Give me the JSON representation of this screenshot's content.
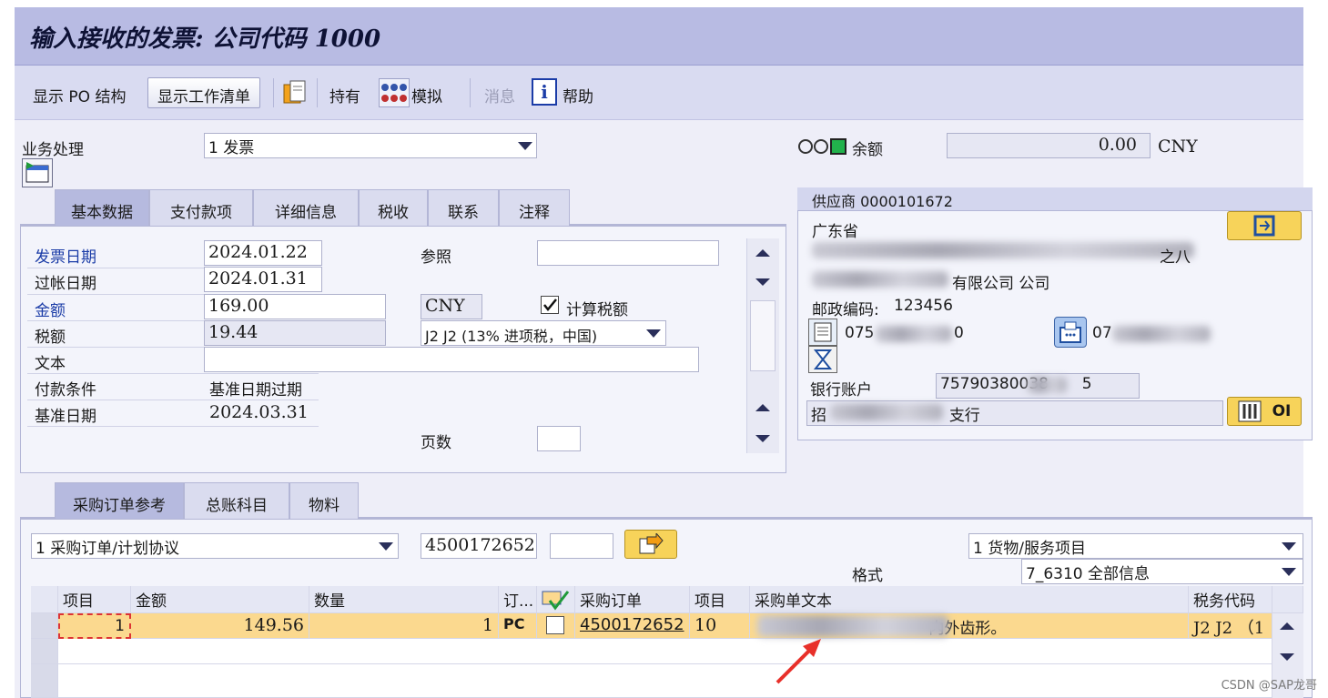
{
  "window": {
    "title": "输入接收的发票: 公司代码 1000"
  },
  "toolbar": {
    "show_po_structure": "显示 PO 结构",
    "show_worklist": "显示工作清单",
    "hold": "持有",
    "simulate": "模拟",
    "messages": "消息",
    "help": "帮助"
  },
  "header": {
    "transaction_label": "业务处理",
    "transaction_value": "1 发票",
    "balance_label": "余额",
    "balance_value": "0.00",
    "balance_currency": "CNY"
  },
  "tabs_top": [
    "基本数据",
    "支付款项",
    "详细信息",
    "税收",
    "联系",
    "注释"
  ],
  "basic_data": {
    "invoice_date_label": "发票日期",
    "invoice_date": "2024.01.22",
    "posting_date_label": "过帐日期",
    "posting_date": "2024.01.31",
    "amount_label": "金额",
    "amount": "169.00",
    "currency": "CNY",
    "calc_tax_label": "计算税额",
    "calc_tax_checked": true,
    "tax_amount_label": "税额",
    "tax_amount": "19.44",
    "tax_code": "J2 J2 (13% 进项税，中国)",
    "text_label": "文本",
    "text_value": "",
    "reference_label": "参照",
    "reference_value": "",
    "payment_terms_label": "付款条件",
    "payment_terms_value": "基准日期过期",
    "baseline_date_label": "基准日期",
    "baseline_date": "2024.03.31",
    "pages_label": "页数",
    "pages_value": ""
  },
  "vendor": {
    "title": "供应商 0000101672",
    "province": "广东省",
    "address_suffix": "之八",
    "company_suffix": "有限公司 公司",
    "postal_label": "邮政编码:",
    "postal_code": "123456",
    "phone_prefix": "075",
    "phone_suffix": "0",
    "fax_prefix": "07",
    "bank_account_label": "银行账户",
    "bank_account_prefix": "75790380038",
    "bank_account_suffix": "5",
    "bank_prefix": "招",
    "bank_suffix": "支行",
    "oi_label": "OI"
  },
  "tabs_bottom": [
    "采购订单参考",
    "总账科目",
    "物料"
  ],
  "po_ref": {
    "doc_type": "1 采购订单/计划协议",
    "po_number": "4500172652",
    "item_type": "1 货物/服务项目",
    "format_label": "格式",
    "format_value": "7_6310 全部信息"
  },
  "table": {
    "headers": [
      "项目",
      "金额",
      "数量",
      "订...",
      "",
      "采购订单",
      "项目",
      "采购单文本",
      "税务代码"
    ],
    "rows": [
      {
        "item": "1",
        "amount": "149.56",
        "qty": "1",
        "unit": "PC",
        "po": "4500172652",
        "po_item": "10",
        "text_suffix": "内外齿形。",
        "tax": "J2  J2 （1"
      }
    ]
  },
  "watermark": "CSDN @SAP龙哥",
  "colors": {
    "title_bg": "#b8bbe3",
    "row_highlight": "#fbd98f",
    "arrow_annotation": "#e8302a"
  }
}
